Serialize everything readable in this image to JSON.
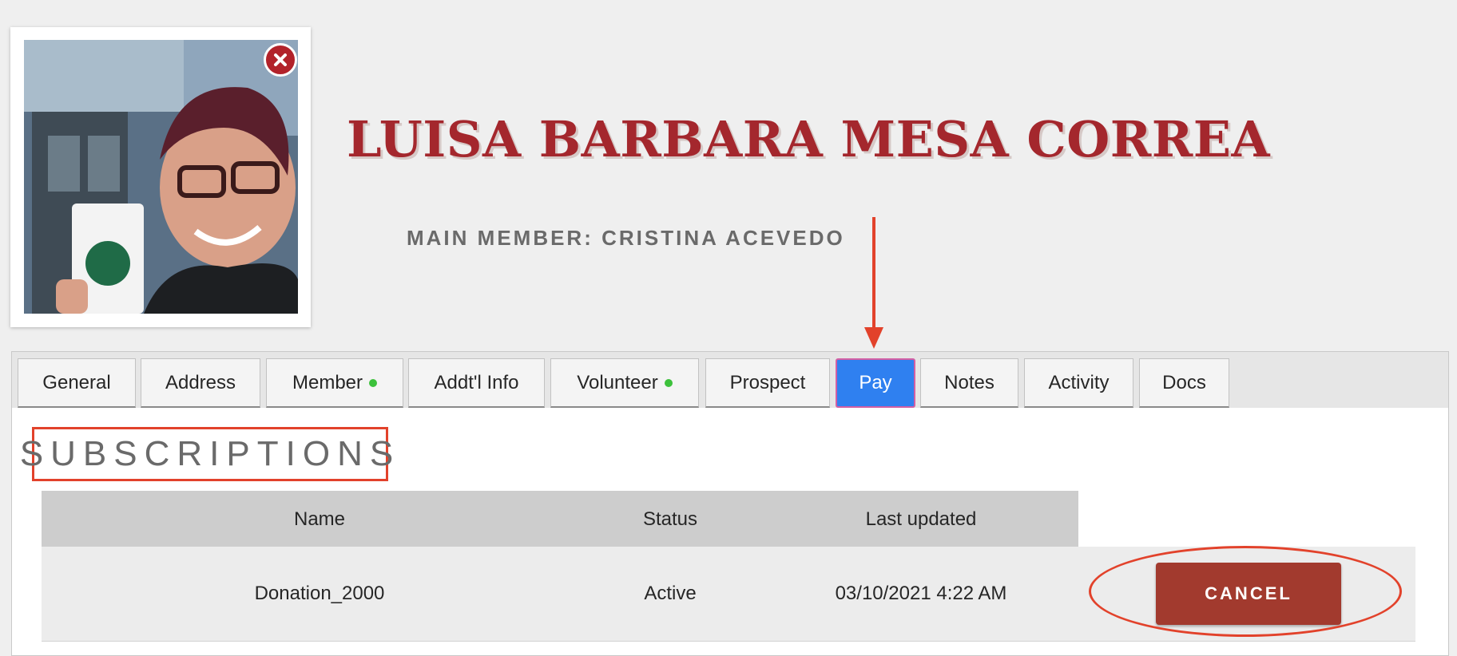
{
  "profile": {
    "name": "LUISA BARBARA MESA CORREA",
    "main_member": "MAIN MEMBER: CRISTINA ACEVEDO",
    "photo_icon": "avatar-photo",
    "close_icon": "close-icon"
  },
  "tabs": [
    {
      "label": "General",
      "active": false,
      "indicator": false
    },
    {
      "label": "Address",
      "active": false,
      "indicator": false
    },
    {
      "label": "Member",
      "active": false,
      "indicator": true
    },
    {
      "label": "Addt'l Info",
      "active": false,
      "indicator": false
    },
    {
      "label": "Volunteer",
      "active": false,
      "indicator": true
    },
    {
      "label": "Prospect",
      "active": false,
      "indicator": false
    },
    {
      "label": "Pay",
      "active": true,
      "indicator": false
    },
    {
      "label": "Notes",
      "active": false,
      "indicator": false
    },
    {
      "label": "Activity",
      "active": false,
      "indicator": false
    },
    {
      "label": "Docs",
      "active": false,
      "indicator": false
    }
  ],
  "subscriptions": {
    "title": "SUBSCRIPTIONS",
    "columns": [
      "Name",
      "Status",
      "Last updated"
    ],
    "rows": [
      {
        "name": "Donation_2000",
        "status": "Active",
        "last_updated": "03/10/2021 4:22 AM",
        "action_label": "CANCEL"
      }
    ]
  },
  "colors": {
    "name": "#a4272d",
    "active_tab": "#2f80f0",
    "indicator_dot": "#3cc13b",
    "cancel_button": "#a23a2e",
    "annotation": "#e2422b"
  }
}
